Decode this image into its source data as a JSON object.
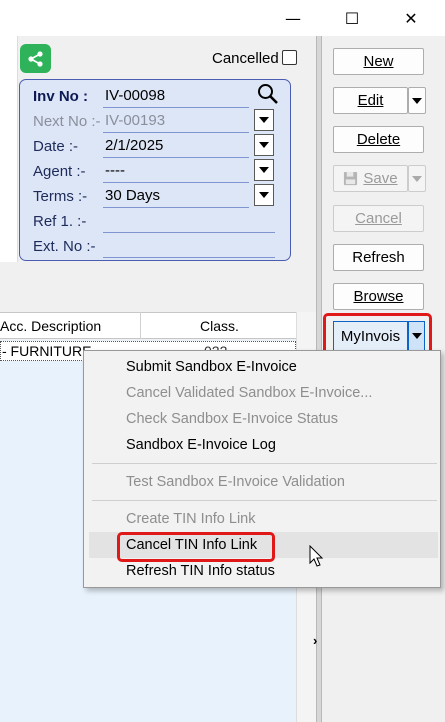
{
  "window": {
    "minimize": "—",
    "maximize": "☐",
    "close": "✕"
  },
  "header": {
    "cancelled_label": "Cancelled",
    "cancelled_checked": false
  },
  "invoice": {
    "inv_no_label": "Inv No :",
    "inv_no": "IV-00098",
    "next_no_label": "Next No :-",
    "next_no": "IV-00193",
    "date_label": "Date :-",
    "date": "2/1/2025",
    "agent_label": "Agent :-",
    "agent": "----",
    "terms_label": "Terms :-",
    "terms": "30 Days",
    "ref1_label": "Ref 1. :-",
    "ref1": "",
    "extno_label": "Ext. No :-",
    "extno": ""
  },
  "grid": {
    "columns": [
      "Acc. Description",
      "Class."
    ],
    "rows": [
      {
        "desc": "- FURNITURE",
        "class": "022"
      }
    ]
  },
  "toolbar": {
    "new": "New",
    "edit": "Edit",
    "delete": "Delete",
    "save": "Save",
    "cancel": "Cancel",
    "refresh": "Refresh",
    "browse": "Browse",
    "myinvois": "MyInvois"
  },
  "menu": {
    "items": [
      {
        "label": "Submit Sandbox E-Invoice",
        "enabled": true
      },
      {
        "label": "Cancel Validated Sandbox E-Invoice...",
        "enabled": false
      },
      {
        "label": "Check Sandbox E-Invoice Status",
        "enabled": false
      },
      {
        "label": "Sandbox E-Invoice Log",
        "enabled": true
      },
      {
        "label": "Test Sandbox E-Invoice Validation",
        "enabled": false
      },
      {
        "label": "Create TIN Info Link",
        "enabled": false
      },
      {
        "label": "Cancel TIN Info Link",
        "enabled": true,
        "highlighted": true
      },
      {
        "label": "Refresh TIN Info status",
        "enabled": true
      }
    ]
  },
  "colors": {
    "accent": "#0a64c9",
    "highlight": "#e01818",
    "share": "#2fb35a",
    "panel": "#dde6f6"
  }
}
